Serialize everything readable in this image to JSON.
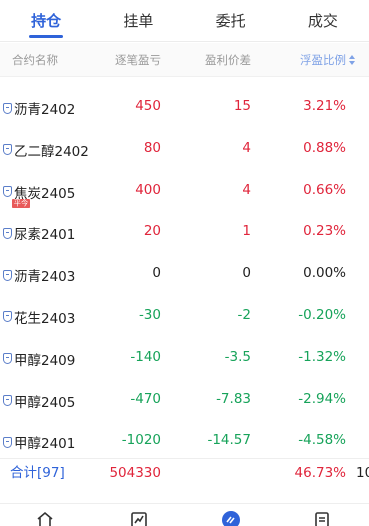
{
  "tabs": [
    {
      "label": "持仓"
    },
    {
      "label": "挂单"
    },
    {
      "label": "委托"
    },
    {
      "label": "成交"
    }
  ],
  "column_headers": {
    "name": "合约名称",
    "pnl": "逐笔盈亏",
    "price_diff": "盈利价差",
    "ratio": "浮盈比例"
  },
  "positions": [
    {
      "name": "沥青2402",
      "pnl": "450",
      "price_diff": "15",
      "ratio": "3.21%",
      "trend": "up",
      "tag": ""
    },
    {
      "name": "乙二醇2402",
      "pnl": "80",
      "price_diff": "4",
      "ratio": "0.88%",
      "trend": "up",
      "tag": ""
    },
    {
      "name": "焦炭2405",
      "pnl": "400",
      "price_diff": "4",
      "ratio": "0.66%",
      "trend": "up",
      "tag": "平今"
    },
    {
      "name": "尿素2401",
      "pnl": "20",
      "price_diff": "1",
      "ratio": "0.23%",
      "trend": "up",
      "tag": ""
    },
    {
      "name": "沥青2403",
      "pnl": "0",
      "price_diff": "0",
      "ratio": "0.00%",
      "trend": "flat",
      "tag": ""
    },
    {
      "name": "花生2403",
      "pnl": "-30",
      "price_diff": "-2",
      "ratio": "-0.20%",
      "trend": "down",
      "tag": ""
    },
    {
      "name": "甲醇2409",
      "pnl": "-140",
      "price_diff": "-3.5",
      "ratio": "-1.32%",
      "trend": "down",
      "tag": ""
    },
    {
      "name": "甲醇2405",
      "pnl": "-470",
      "price_diff": "-7.83",
      "ratio": "-2.94%",
      "trend": "down",
      "tag": ""
    },
    {
      "name": "甲醇2401",
      "pnl": "-1020",
      "price_diff": "-14.57",
      "ratio": "-4.58%",
      "trend": "down",
      "tag": ""
    }
  ],
  "total": {
    "label": "合计[97]",
    "pnl": "504330",
    "ratio": "46.73%",
    "extra": "10"
  },
  "colors": {
    "accent": "#2f63d9",
    "up": "#e0253b",
    "down": "#17a35a"
  },
  "bottom_nav": [
    "home-icon",
    "chart-icon",
    "trade-icon",
    "list-icon"
  ]
}
